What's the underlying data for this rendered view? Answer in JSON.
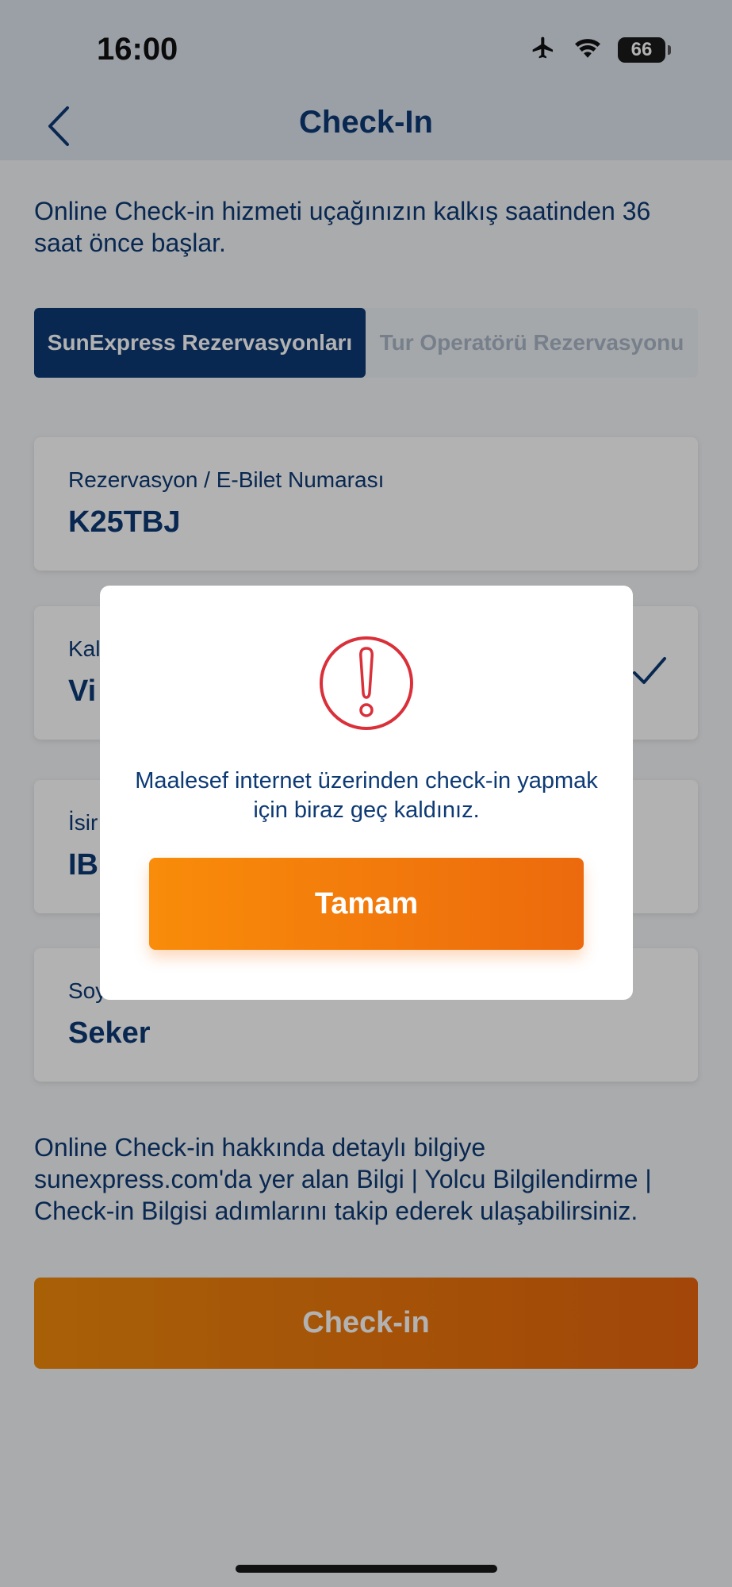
{
  "status_bar": {
    "time": "16:00",
    "battery": "66"
  },
  "nav": {
    "title": "Check-In"
  },
  "intro_text": "Online Check-in hizmeti uçağınızın kalkış saatinden 36 saat önce başlar.",
  "tabs": [
    {
      "label": "SunExpress Rezervasyonları",
      "active": true
    },
    {
      "label": "Tur Operatörü Rezervasyonu",
      "active": false
    }
  ],
  "fields": {
    "reservation": {
      "label": "Rezervasyon / E-Bilet Numarası",
      "value": "K25TBJ"
    },
    "departure": {
      "label": "Kal",
      "value": "Vi"
    },
    "first_name": {
      "label": "İsir",
      "value": "IB"
    },
    "last_name": {
      "label": "Soy",
      "value": "Seker"
    }
  },
  "info_text": "Online Check-in hakkında detaylı bilgiye sunexpress.com'da yer alan Bilgi | Yolcu Bilgilendirme | Check-in Bilgisi adımlarını takip ederek ulaşabilirsiniz.",
  "checkin_button": "Check-in",
  "modal": {
    "message": "Maalesef internet üzerinden check-in yapmak için biraz geç kaldınız.",
    "button": "Tamam"
  },
  "colors": {
    "brand_navy": "#0d3a75",
    "accent_orange": "#f18a0b",
    "alert_red": "#d9303a"
  },
  "icons": {
    "back": "chevron-left-icon",
    "alert": "exclamation-circle-icon",
    "check": "checkmark-icon"
  }
}
